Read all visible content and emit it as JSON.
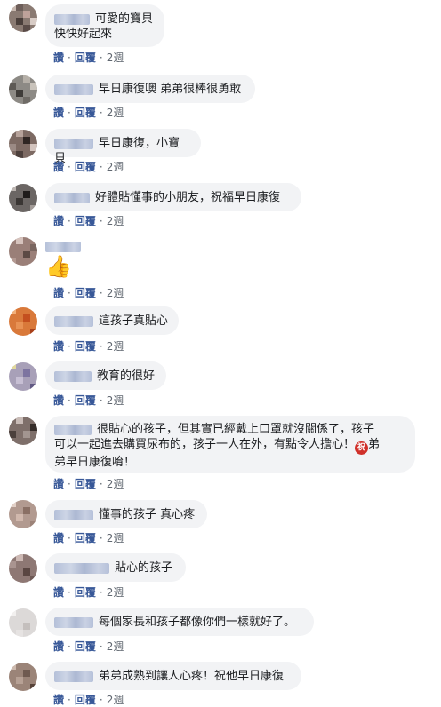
{
  "actions": {
    "like": "讚",
    "reply": "回覆",
    "sep": "·"
  },
  "comments": [
    {
      "lines": [
        "可愛的寶貝",
        "快快好起來"
      ],
      "time": "2週"
    },
    {
      "text": "早日康復噢 弟弟很棒很勇敢",
      "time": "2週"
    },
    {
      "text": "早日康復，小寶貝",
      "time": "2週"
    },
    {
      "text": "好體貼懂事的小朋友，祝福早日康復",
      "time": "2週"
    },
    {
      "sticker": "👍",
      "sticker_name": "thumbs-up",
      "time": "2週"
    },
    {
      "text": "這孩子真貼心",
      "time": "2週"
    },
    {
      "text": "教育的很好",
      "time": "2週"
    },
    {
      "line1": "很貼心的孩子，但其實已經戴上口罩就沒關係了，孩子",
      "line2": "可以一起進去購買尿布的，孩子一人在外，有點令人擔心！",
      "emoji": "祝",
      "line2b": "弟",
      "line3": "弟早日康復唷！",
      "time": "2週"
    },
    {
      "text": "懂事的孩子 真心疼",
      "time": "2週"
    },
    {
      "text": "貼心的孩子",
      "time": "2週"
    },
    {
      "text": "每個家長和孩子都像你們一樣就好了。",
      "time": "2週"
    },
    {
      "text": "弟弟成熟到讓人心疼！祝他早日康復",
      "time": "2週"
    }
  ],
  "colors": {
    "link": "#385898",
    "bubble": "#f2f3f5",
    "meta": "#606770"
  }
}
